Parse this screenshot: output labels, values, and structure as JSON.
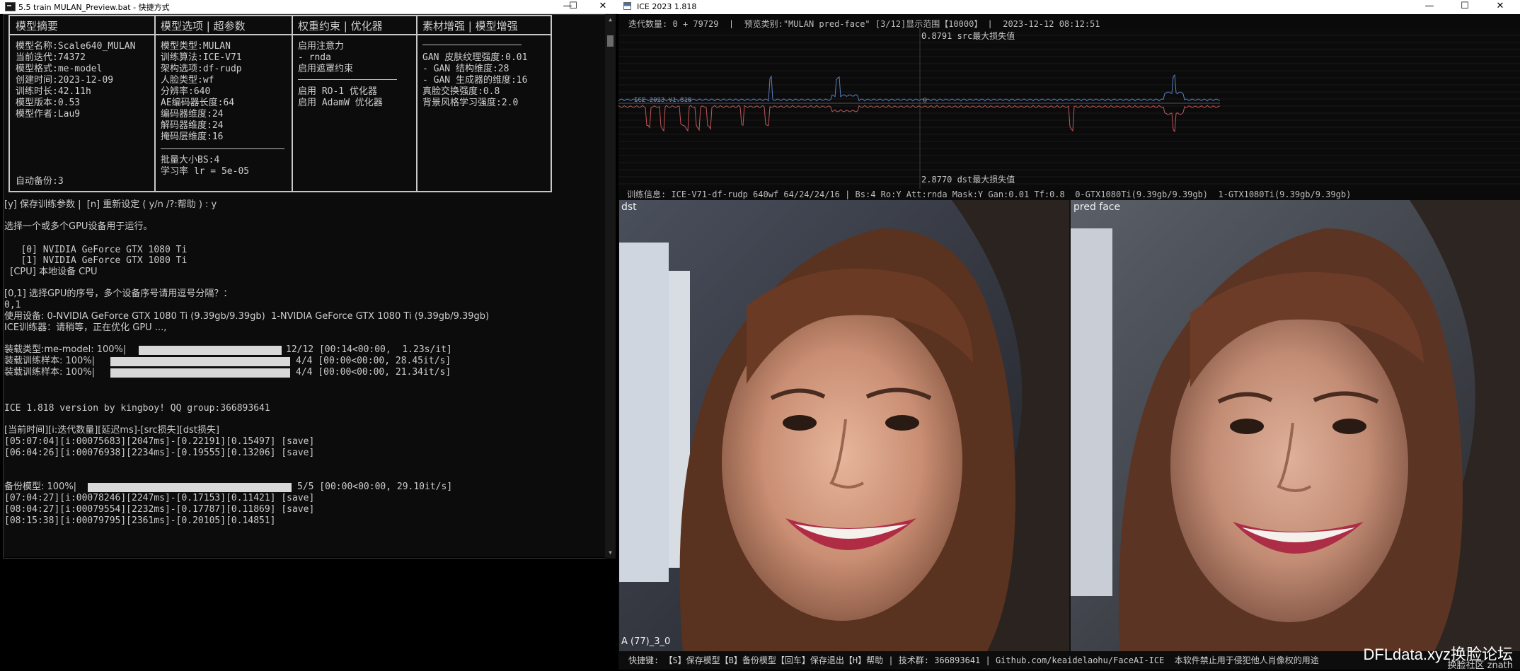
{
  "console": {
    "title": "5.5 train MULAN_Preview.bat - 快捷方式",
    "controls": {
      "minimize": "—",
      "maximize": "☐",
      "close": "✕"
    },
    "table": {
      "headers": [
        "模型摘要",
        "模型选项 | 超参数",
        "权重约束 | 优化器",
        "素材增强 | 模型增强"
      ],
      "col1": [
        "模型名称:Scale640_MULAN",
        "当前迭代:74372",
        "模型格式:me-model",
        "创建时间:2023-12-09",
        "训练时长:42.11h",
        "模型版本:0.53",
        "模型作者:Lau9"
      ],
      "col1_footer": "自动备份:3",
      "col2": [
        "模型类型:MULAN",
        "训练算法:ICE-V71",
        "架构选项:df-rudp",
        "人脸类型:wf",
        "分辨率:640",
        "AE编码器长度:64",
        "编码器维度:24",
        "解码器维度:24",
        "掩码层维度:16"
      ],
      "col2_footer": [
        "批量大小BS:4",
        "学习率 lr = 5e-05"
      ],
      "col3_top": [
        "启用注意力",
        "- rnda",
        "启用遮罩约束"
      ],
      "col3_bottom": [
        "启用 RO-1 优化器",
        "启用 AdamW 优化器"
      ],
      "col4": [
        "GAN 皮肤纹理强度:0.01",
        "- GAN 结构维度:28",
        "- GAN 生成器的维度:16",
        "真脸交换强度:0.8",
        "背景风格学习强度:2.0"
      ]
    },
    "lines": {
      "prompt_save": "[y] 保存训练参数 |  [n] 重新设定 ( y/n /?:帮助 ) : y",
      "gpu_choose": "选择一个或多个GPU设备用于运行。",
      "gpu0": "   [0] NVIDIA GeForce GTX 1080 Ti",
      "gpu1": "   [1] NVIDIA GeForce GTX 1080 Ti",
      "gpu_cpu": "  [CPU] 本地设备 CPU",
      "gpu_prompt": "[0,1] 选择GPU的序号，多个设备序号请用逗号分隔？：",
      "gpu_answer": "0,1",
      "devices": "使用设备: 0-NVIDIA GeForce GTX 1080 Ti (9.39gb/9.39gb)  1-NVIDIA GeForce GTX 1080 Ti (9.39gb/9.39gb)",
      "optimizing": "ICE训练器：请稍等，正在优化 GPU ...,",
      "load_model_label": "装载类型:me-model: 100%|",
      "load_model_stats": "12/12 [00:14<00:00,  1.23s/it]",
      "load_sample1_label": "装载训练样本: 100%|",
      "load_sample1_stats": "4/4 [00:00<00:00, 28.45it/s]",
      "load_sample2_label": "装载训练样本: 100%|",
      "load_sample2_stats": "4/4 [00:00<00:00, 21.34it/s]",
      "version": "ICE 1.818 version by kingboy! QQ group:366893641",
      "log_header": "[当前时间][i:迭代数量][延迟ms]-[src损失][dst损失]",
      "log1": "[05:07:04][i:00075683][2047ms]-[0.22191][0.15497] [save]",
      "log2": "[06:04:26][i:00076938][2234ms]-[0.19555][0.13206] [save]",
      "backup_label": "备份模型: 100%|",
      "backup_stats": "5/5 [00:00<00:00, 29.10it/s]",
      "log3": "[07:04:27][i:00078246][2247ms]-[0.17153][0.11421] [save]",
      "log4": "[08:04:27][i:00079554][2232ms]-[0.17787][0.11869] [save]",
      "log5": "[08:15:38][i:00079795][2361ms]-[0.20105][0.14851]"
    }
  },
  "preview": {
    "title": "ICE 2023  1.818",
    "info_line": "迭代数量: 0 + 79729  |  预览类别:\"MULAN pred-face\" [3/12]显示范围【10000】 |  2023-12-12 08:12:51",
    "graph": {
      "src_label": "0.8791 src最大损失值",
      "dst_label": "2.8770 dst最大损失值",
      "mid_tag": "ICE 2023 V1.818",
      "zero": "0",
      "src_color": "#5b7fc4",
      "dst_color": "#c4575b"
    },
    "train_info": "训练信息: ICE-V71-df-rudp 640wf 64/24/24/16 | Bs:4 Ro:Y Att:rnda Mask:Y Gan:0.01 Tf:0.8  0-GTX1080Ti(9.39gb/9.39gb)  1-GTX1080Ti(9.39gb/9.39gb)",
    "panel_left_label": "dst",
    "panel_right_label": "pred face",
    "frame_label": "A (77)_3_0",
    "status": "快捷键: 【S】保存模型【B】备份模型【回车】保存退出【H】帮助 | 技术群: 366893641 | Github.com/keaidelaohu/FaceAI-ICE  本软件禁止用于侵犯他人肖像权的用途",
    "watermark": "DFLdata.xyz换脸论坛",
    "watermark_sub": "换脸社区 znath"
  }
}
